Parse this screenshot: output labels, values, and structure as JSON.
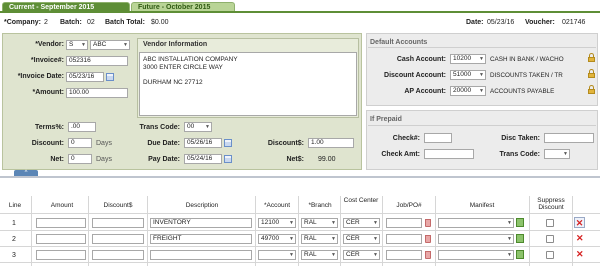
{
  "tabs": [
    {
      "label": "Current - September 2015"
    },
    {
      "label": "Future - October 2015"
    }
  ],
  "header": {
    "company_label": "*Company:",
    "company_value": "2",
    "batch_label": "Batch:",
    "batch_value": "02",
    "batch_total_label": "Batch Total:",
    "batch_total_value": "$0.00",
    "date_label": "Date:",
    "date_value": "05/23/16",
    "voucher_label": "Voucher:",
    "voucher_value": "021746"
  },
  "form": {
    "vendor_label": "*Vendor:",
    "vendor_type": "S",
    "vendor_code": "ABC",
    "invoice_label": "*Invoice#:",
    "invoice_value": "052316",
    "invoice_date_label": "*Invoice Date:",
    "invoice_date_value": "05/23/16",
    "amount_label": "*Amount:",
    "amount_value": "100.00",
    "vendor_info_title": "Vendor Information",
    "vendor_address": [
      "ABC INSTALLATION COMPANY",
      "3000 ENTER CIRCLE WAY",
      "",
      "DURHAM NC 27712"
    ],
    "terms_label": "Terms%:",
    "terms_value": ".00",
    "discount_label": "Discount:",
    "discount_value": "0",
    "days1": "Days",
    "net_label": "Net:",
    "net_value": "0",
    "days2": "Days",
    "trans_code_label": "Trans Code:",
    "trans_code_value": "00",
    "due_date_label": "Due Date:",
    "due_date_value": "05/26/16",
    "pay_date_label": "Pay Date:",
    "pay_date_value": "05/24/16",
    "discount_amt_label": "Discount$:",
    "discount_amt_value": "1.00",
    "net_amt_label": "Net$:",
    "net_amt_value": "99.00"
  },
  "default_accounts": {
    "title": "Default Accounts",
    "cash_label": "Cash Account:",
    "cash_code": "10200",
    "cash_name": "CASH IN BANK / WACHO",
    "discount_label": "Discount Account:",
    "discount_code": "51000",
    "discount_name": "DISCOUNTS TAKEN / TR",
    "ap_label": "AP Account:",
    "ap_code": "20000",
    "ap_name": "ACCOUNTS PAYABLE"
  },
  "if_prepaid": {
    "title": "If Prepaid",
    "check_label": "Check#:",
    "check_value": "",
    "disc_taken_label": "Disc Taken:",
    "disc_taken_value": "",
    "check_amt_label": "Check Amt:",
    "check_amt_value": "",
    "trans_code_label": "Trans Code:",
    "trans_code_value": ""
  },
  "grid": {
    "collapse_label": "^",
    "headers": {
      "line": "Line",
      "amount": "Amount",
      "discount": "Discount$",
      "description": "Description",
      "account": "*Account",
      "branch": "*Branch",
      "cost_center": "Cost Center",
      "job_po": "Job/PO#",
      "manifest": "Manifest",
      "suppress": "Suppress Discount"
    },
    "rows": [
      {
        "line": "1",
        "amount": "",
        "discount": "",
        "description": "INVENTORY",
        "account": "12100",
        "branch": "RAL",
        "cost_center": "CER",
        "job_po": "",
        "manifest": ""
      },
      {
        "line": "2",
        "amount": "",
        "discount": "",
        "description": "FREIGHT",
        "account": "49700",
        "branch": "RAL",
        "cost_center": "CER",
        "job_po": "",
        "manifest": ""
      },
      {
        "line": "3",
        "amount": "",
        "discount": "",
        "description": "",
        "account": "",
        "branch": "RAL",
        "cost_center": "CER",
        "job_po": "",
        "manifest": ""
      }
    ]
  },
  "colors": {
    "tab_active": "#5e8e36",
    "tab_inactive": "#b9d496",
    "form_panel": "#dfe4cf",
    "side_panel": "#ececec",
    "delete_red": "#d62121"
  }
}
